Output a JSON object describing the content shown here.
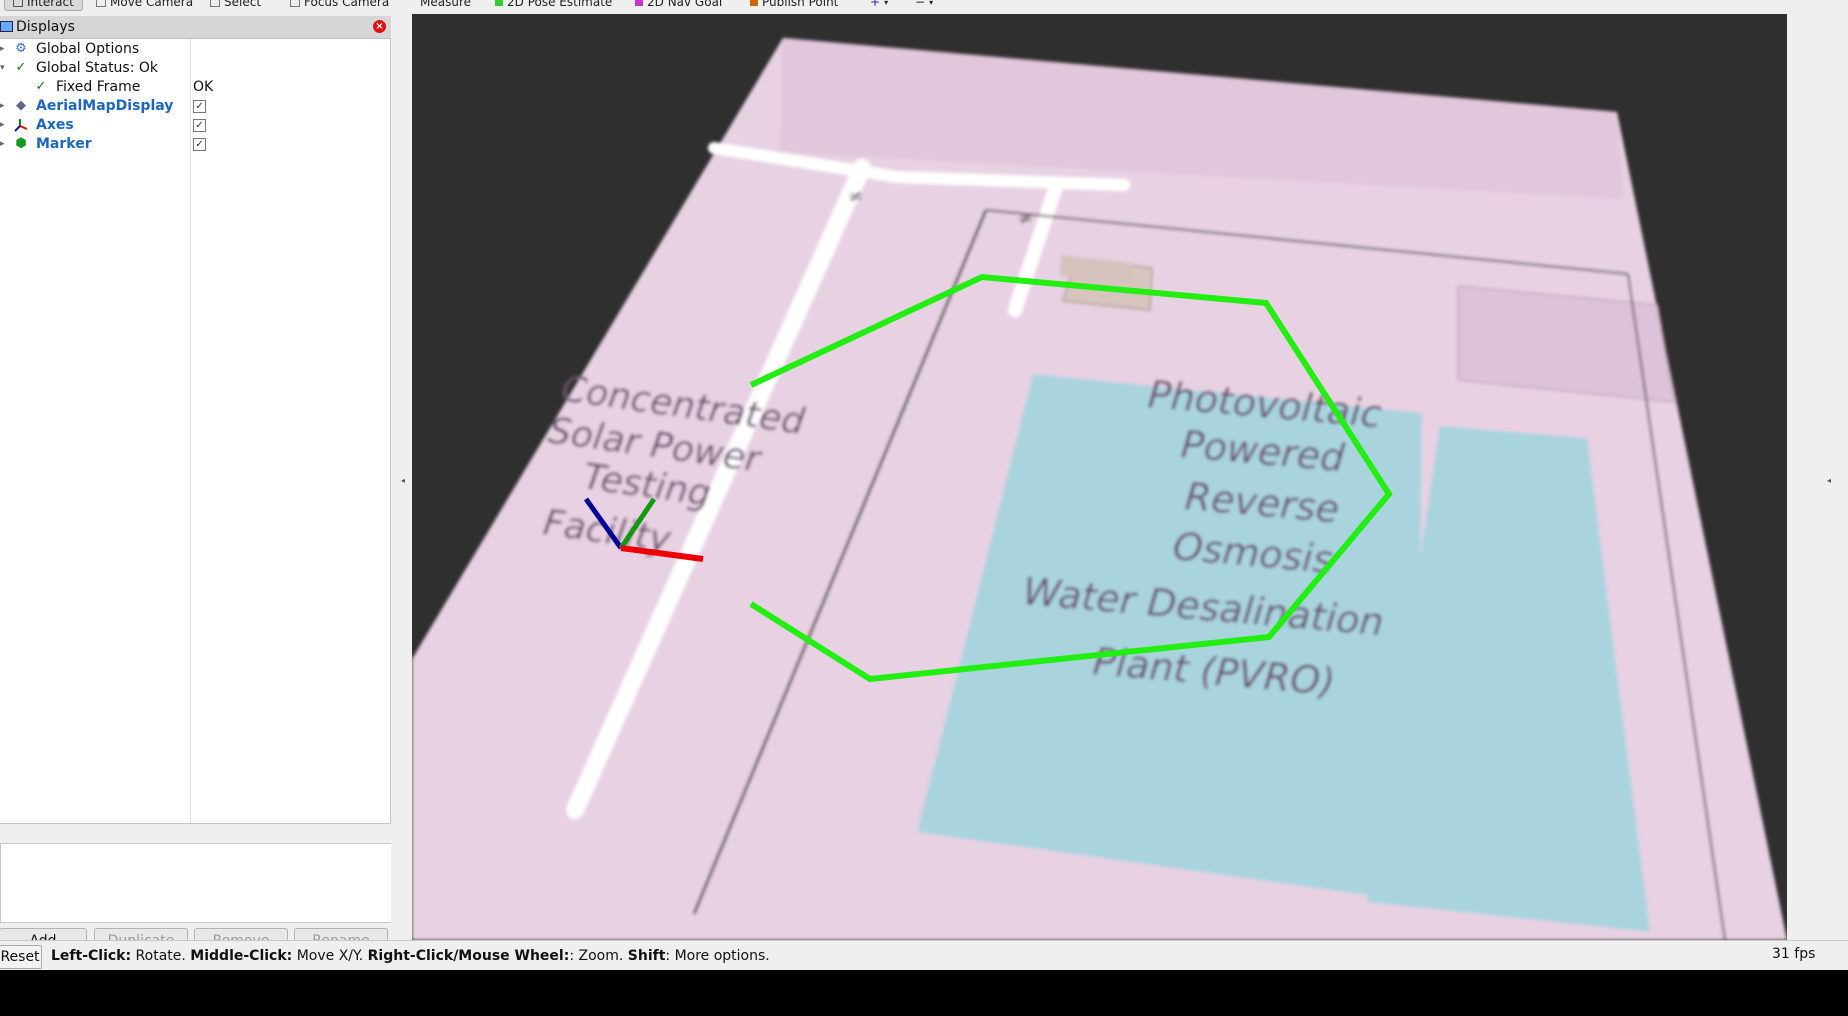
{
  "toolbar": {
    "tools": [
      {
        "label": "Interact",
        "active": true
      },
      {
        "label": "Move Camera"
      },
      {
        "label": "Select"
      },
      {
        "label": "Focus Camera"
      },
      {
        "label": "Measure"
      },
      {
        "label": "2D Pose Estimate"
      },
      {
        "label": "2D Nav Goal"
      },
      {
        "label": "Publish Point"
      }
    ]
  },
  "displays": {
    "title": "Displays",
    "items": [
      {
        "label": "Global Options",
        "value": ""
      },
      {
        "label": "Global Status: Ok",
        "value": ""
      },
      {
        "label": "Fixed Frame",
        "value": "OK"
      },
      {
        "label": "AerialMapDisplay",
        "checked": "✓"
      },
      {
        "label": "Axes",
        "checked": "✓"
      },
      {
        "label": "Marker",
        "checked": "✓"
      }
    ],
    "buttons": {
      "add": "Add",
      "duplicate": "Duplicate",
      "remove": "Remove",
      "rename": "Rename"
    }
  },
  "map": {
    "left_label": [
      "Concentrated",
      "Solar Power",
      "Testing",
      "Facility"
    ],
    "right_label": [
      "Photovoltaic",
      "Powered",
      "Reverse",
      "Osmosis",
      "Water Desalination",
      "Plant (PVRO)"
    ],
    "colors": {
      "ground": "#e6d0e2",
      "water": "#a9d4de",
      "path": "#22ee11",
      "axis_x": "#ee0000",
      "axis_y": "#119911",
      "axis_z": "#000099"
    }
  },
  "status": {
    "reset": "Reset",
    "left_click_key": "Left-Click:",
    "left_click_action": "Rotate.",
    "middle_click_key": "Middle-Click:",
    "middle_click_action": "Move X/Y.",
    "right_click_key": "Right-Click/Mouse Wheel:",
    "right_click_action": ": Zoom.",
    "shift_key": "Shift",
    "shift_action": ": More options.",
    "fps": "31 fps"
  }
}
